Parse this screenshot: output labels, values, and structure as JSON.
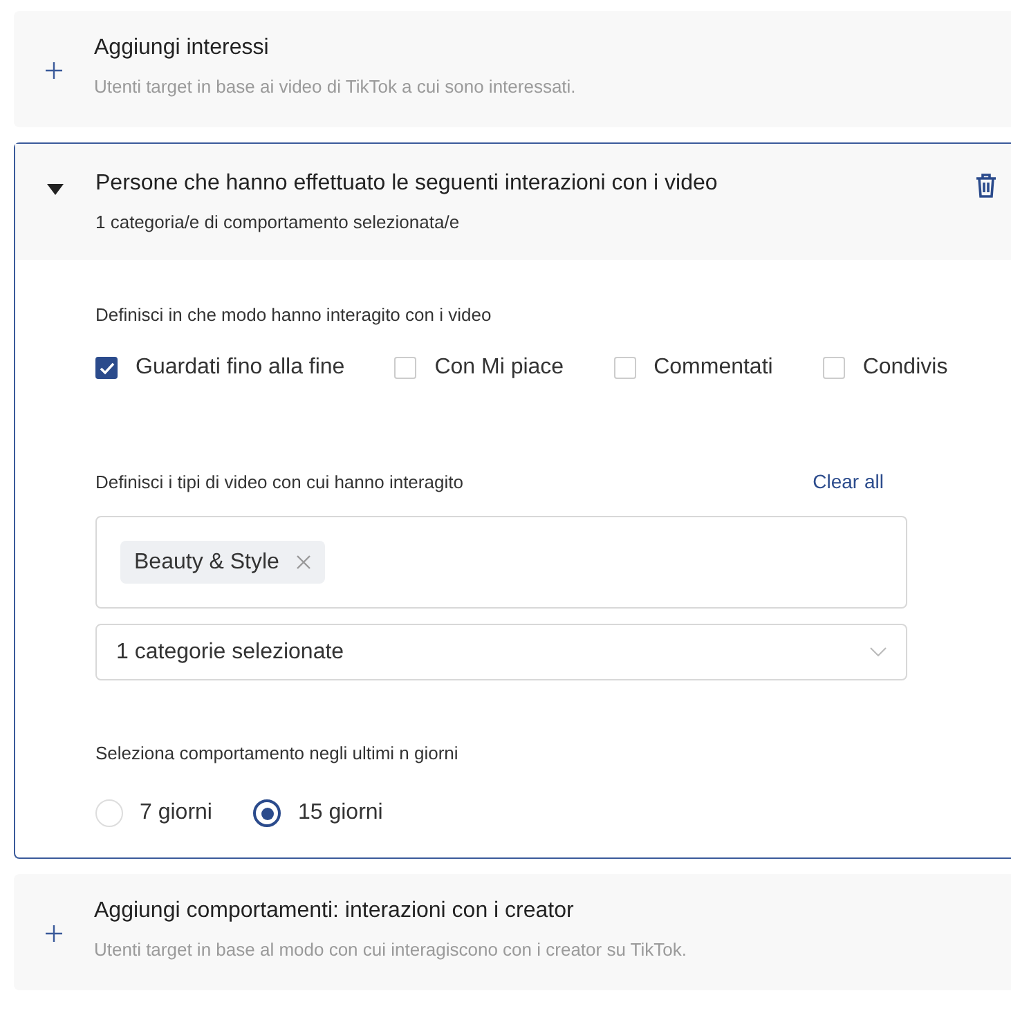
{
  "sections": [
    {
      "expanded": false,
      "title": "Aggiungi interessi",
      "subtitle": "Utenti target in base ai video di TikTok a cui sono interessati."
    },
    {
      "expanded": true,
      "title": "Persone che hanno effettuato le seguenti interazioni con i video",
      "subtitle": "1 categoria/e di comportamento selezionata/e",
      "interactions": {
        "label": "Definisci in che modo hanno interagito con i video",
        "options": [
          {
            "label": "Guardati fino alla fine",
            "checked": true
          },
          {
            "label": "Con Mi piace",
            "checked": false
          },
          {
            "label": "Commentati",
            "checked": false
          },
          {
            "label": "Condivis",
            "checked": false
          }
        ]
      },
      "video_types": {
        "label": "Definisci i tipi di video con cui hanno interagito",
        "clear_link": "Clear all",
        "tags": [
          "Beauty & Style"
        ],
        "select_value": "1 categorie selezionate"
      },
      "period": {
        "label": "Seleziona comportamento negli ultimi n giorni",
        "options": [
          {
            "label": "7 giorni",
            "selected": false
          },
          {
            "label": "15 giorni",
            "selected": true
          }
        ]
      }
    },
    {
      "expanded": false,
      "title": "Aggiungi comportamenti: interazioni con i creator",
      "subtitle": "Utenti target in base al modo con cui interagiscono con i creator su TikTok."
    }
  ]
}
